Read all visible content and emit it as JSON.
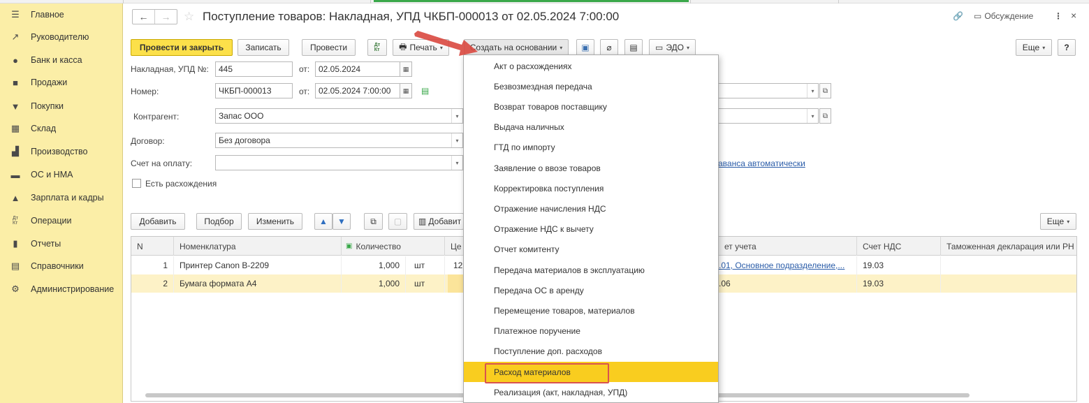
{
  "sidebar": {
    "items": [
      {
        "label": "Главное",
        "icon": "menu-icon"
      },
      {
        "label": "Руководителю",
        "icon": "trend-icon"
      },
      {
        "label": "Банк и касса",
        "icon": "coin-icon"
      },
      {
        "label": "Продажи",
        "icon": "bag-icon"
      },
      {
        "label": "Покупки",
        "icon": "cart-icon"
      },
      {
        "label": "Склад",
        "icon": "warehouse-icon"
      },
      {
        "label": "Производство",
        "icon": "factory-icon"
      },
      {
        "label": "ОС и НМА",
        "icon": "truck-icon"
      },
      {
        "label": "Зарплата и кадры",
        "icon": "person-icon"
      },
      {
        "label": "Операции",
        "icon": "dt-kt-icon"
      },
      {
        "label": "Отчеты",
        "icon": "bar-chart-icon"
      },
      {
        "label": "Справочники",
        "icon": "book-icon"
      },
      {
        "label": "Администрирование",
        "icon": "gear-icon"
      }
    ]
  },
  "header": {
    "title": "Поступление товаров: Накладная, УПД ЧКБП-000013 от 02.05.2024 7:00:00",
    "discussion_label": "Обсуждение"
  },
  "toolbar": {
    "post_close": "Провести и закрыть",
    "save": "Записать",
    "post": "Провести",
    "dtkt": "Дт Кт",
    "print": "Печать",
    "create_based": "Создать на основании",
    "edo": "ЭДО",
    "more": "Еще",
    "help": "?"
  },
  "form": {
    "invoice_label": "Накладная, УПД №:",
    "invoice_value": "445",
    "from_label": "от:",
    "invoice_date": "02.05.2024",
    "number_label": "Номер:",
    "number_value": "ЧКБП-000013",
    "number_date": "02.05.2024  7:00:00",
    "counterparty_label": "Контрагент:",
    "counterparty_value": "Запас ООО",
    "contract_label": "Договор:",
    "contract_value": "Без договора",
    "payment_label": "Счет на оплату:",
    "payment_value": "",
    "discrepancy_label": "Есть расхождения",
    "advance_link": "аванса автоматически"
  },
  "table_toolbar": {
    "add": "Добавить",
    "pick": "Подбор",
    "edit": "Изменить",
    "add2": "Добавит",
    "more": "Еще"
  },
  "table": {
    "headers": {
      "n": "N",
      "item": "Номенклатура",
      "qty": "Количество",
      "price": "Це",
      "account": "ет учета",
      "vat_account": "Счет НДС",
      "customs": "Таможенная декларация или РН"
    },
    "rows": [
      {
        "n": "1",
        "item": "Принтер Canon B-2209",
        "qty": "1,000",
        "unit": "шт",
        "price": "12",
        "account": ".01, Основное подразделение,...",
        "vat_account": "19.03"
      },
      {
        "n": "2",
        "item": "Бумага формата А4",
        "qty": "1,000",
        "unit": "шт",
        "price": "",
        "account": ".06",
        "vat_account": "19.03"
      }
    ]
  },
  "dropdown": {
    "items": [
      "Акт о расхождениях",
      "Безвозмездная передача",
      "Возврат товаров поставщику",
      "Выдача наличных",
      "ГТД по импорту",
      "Заявление о ввозе товаров",
      "Корректировка поступления",
      "Отражение начисления НДС",
      "Отражение НДС к вычету",
      "Отчет комитенту",
      "Передача материалов в эксплуатацию",
      "Передача ОС в аренду",
      "Перемещение товаров, материалов",
      "Платежное поручение",
      "Поступление доп. расходов",
      "Расход материалов",
      "Реализация (акт, накладная, УПД)"
    ],
    "highlighted": "Расход материалов"
  },
  "colors": {
    "sidebar_bg": "#fbeea7",
    "primary_button": "#fce04a",
    "highlight": "#f9cd1f",
    "annotation_red": "#d9534f",
    "selected_row": "#fdf2c7"
  }
}
